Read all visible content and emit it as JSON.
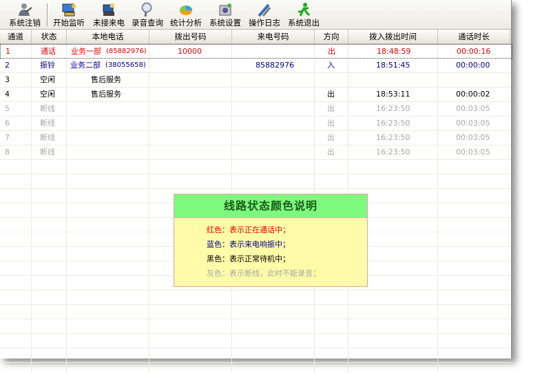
{
  "toolbar": {
    "buttons": [
      {
        "label": "系统注销",
        "icon": "user-icon"
      },
      {
        "label": "开始监听",
        "icon": "monitor-icon"
      },
      {
        "label": "未接来电",
        "icon": "phone-icon"
      },
      {
        "label": "录音查询",
        "icon": "search-icon"
      },
      {
        "label": "统计分析",
        "icon": "pie-chart-icon"
      },
      {
        "label": "系统设置",
        "icon": "settings-icon"
      },
      {
        "label": "操作日志",
        "icon": "pen-icon"
      },
      {
        "label": "系统退出",
        "icon": "exit-icon"
      }
    ]
  },
  "table": {
    "columns": [
      "通道",
      "状态",
      "本地电话",
      "拨出号码",
      "来电号码",
      "方向",
      "拨入拨出时间",
      "通话时长"
    ],
    "rows": [
      {
        "channel": "1",
        "status": "通话",
        "local": "业务一部",
        "local_num": "(85882976)",
        "dial_out": "10000",
        "incoming": "",
        "direction": "出",
        "time": "18:48:59",
        "duration": "00:00:16",
        "color": "red"
      },
      {
        "channel": "2",
        "status": "振铃",
        "local": "业务二部",
        "local_num": "(38055658)",
        "dial_out": "",
        "incoming": "85882976",
        "direction": "入",
        "time": "18:51:45",
        "duration": "00:00:00",
        "color": "blue"
      },
      {
        "channel": "3",
        "status": "空闲",
        "local": "售后服务",
        "local_num": "",
        "dial_out": "",
        "incoming": "",
        "direction": "",
        "time": "",
        "duration": "",
        "color": "black"
      },
      {
        "channel": "4",
        "status": "空闲",
        "local": "售后服务",
        "local_num": "",
        "dial_out": "",
        "incoming": "",
        "direction": "出",
        "time": "18:53:11",
        "duration": "00:00:02",
        "color": "black"
      },
      {
        "channel": "5",
        "status": "断线",
        "local": "",
        "local_num": "",
        "dial_out": "",
        "incoming": "",
        "direction": "出",
        "time": "16:23:50",
        "duration": "00:03:05",
        "color": "gray"
      },
      {
        "channel": "6",
        "status": "断线",
        "local": "",
        "local_num": "",
        "dial_out": "",
        "incoming": "",
        "direction": "出",
        "time": "16:23:50",
        "duration": "00:03:05",
        "color": "gray"
      },
      {
        "channel": "7",
        "status": "断线",
        "local": "",
        "local_num": "",
        "dial_out": "",
        "incoming": "",
        "direction": "出",
        "time": "16:23:50",
        "duration": "00:03:05",
        "color": "gray"
      },
      {
        "channel": "8",
        "status": "断线",
        "local": "",
        "local_num": "",
        "dial_out": "",
        "incoming": "",
        "direction": "出",
        "time": "16:23:50",
        "duration": "00:03:05",
        "color": "gray"
      }
    ]
  },
  "legend": {
    "title": "线路状态颜色说明",
    "lines": [
      {
        "text": "红色：表示正在通话中；",
        "color": "#e00000"
      },
      {
        "text": "蓝色：表示来电响振中；",
        "color": "#00008b"
      },
      {
        "text": "黑色：表示正常待机中；",
        "color": "#000000"
      },
      {
        "text": "灰色：表示断线，此时不能录音；",
        "color": "#a8a8a8"
      }
    ]
  },
  "colors": {
    "red": "#e00000",
    "blue": "#00008b",
    "black": "#000000",
    "gray": "#a8a8a8"
  }
}
